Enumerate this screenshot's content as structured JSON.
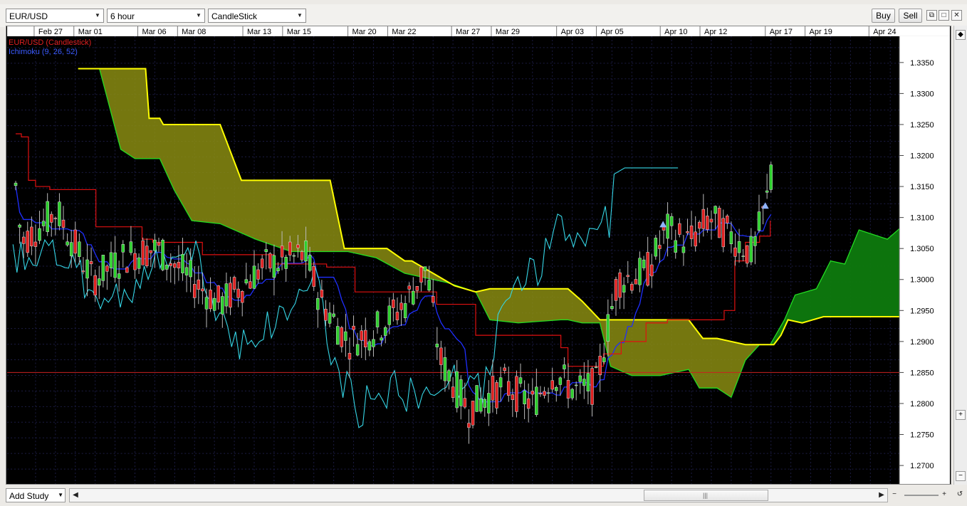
{
  "toolbar": {
    "symbol": "EUR/USD",
    "timeframe": "6 hour",
    "chart_type": "CandleStick",
    "buy_label": "Buy",
    "sell_label": "Sell"
  },
  "chart": {
    "title": "EUR/USD (Candlestick)",
    "indicator_label": "Ichimoku (9, 26, 52)",
    "date_labels": [
      "Feb 27",
      "Mar 01",
      "Mar 06",
      "Mar 08",
      "Mar 13",
      "Mar 15",
      "Mar 20",
      "Mar 22",
      "Mar 27",
      "Mar 29",
      "Apr 03",
      "Apr 05",
      "Apr 10",
      "Apr 12",
      "Apr 17",
      "Apr 19",
      "Apr 24"
    ],
    "price_labels": [
      "1.3350",
      "1.3300",
      "1.3250",
      "1.3200",
      "1.3150",
      "1.3100",
      "1.3050",
      "1.3000",
      "1.2950",
      "1.2900",
      "1.2850",
      "1.2800",
      "1.2750",
      "1.2700"
    ],
    "current_price_label": "1.3100",
    "colors": {
      "background": "#000000",
      "up_candle": "#2dd02d",
      "down_candle": "#e02020",
      "tenkan": "#1f2fff",
      "kijun": "#e01010",
      "chikou": "#35d6e6",
      "senkou_a": "#ffff00",
      "senkou_b": "#22dd22",
      "bearish_cloud": "#8a8c12",
      "bullish_cloud": "#0e7a0e",
      "reference_line": "#c82020"
    },
    "reference_price": 1.285
  },
  "bottom": {
    "add_study_label": "Add Study"
  }
}
